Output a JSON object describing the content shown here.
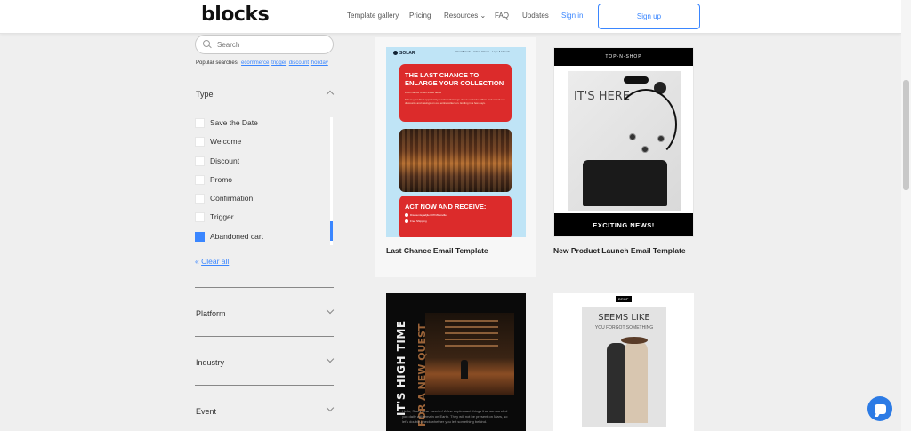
{
  "header": {
    "logo": "blocks",
    "nav": {
      "gallery": "Template gallery",
      "pricing": "Pricing",
      "resources": "Resources ⌄",
      "faq": "FAQ",
      "updates": "Updates",
      "signin": "Sign in"
    },
    "signup": "Sign up"
  },
  "sidebar": {
    "search": {
      "placeholder": "Search"
    },
    "popular": {
      "label": "Popular searches:",
      "links": [
        "ecommerce",
        "trigger",
        "discount",
        "holiday"
      ]
    },
    "type": {
      "title": "Type",
      "options": [
        {
          "label": "Save the Date",
          "checked": false
        },
        {
          "label": "Welcome",
          "checked": false
        },
        {
          "label": "Discount",
          "checked": false
        },
        {
          "label": "Promo",
          "checked": false
        },
        {
          "label": "Confirmation",
          "checked": false
        },
        {
          "label": "Trigger",
          "checked": false
        },
        {
          "label": "Abandoned cart",
          "checked": true
        }
      ]
    },
    "clear_all": "Clear all",
    "clear_prefix": "«",
    "sections": {
      "platform": "Platform",
      "industry": "Industry",
      "event": "Event"
    }
  },
  "cards": {
    "solar": {
      "brand": "SOLAR",
      "nav": [
        "Client Brands",
        "Active Clients",
        "Logo & Visuals"
      ],
      "headline": "THE LAST CHANCE TO ENLARGE YOUR COLLECTION",
      "sub": "Last chance to win these deals",
      "body": "This is your final opportunity to take advantage of our exclusive offers and unlock our discounts and savings on our entire collection. Ending in a few days.",
      "act": "ACT NOW AND RECEIVE:",
      "items": [
        "Discountsgadjiler Off Mitesville",
        "Free Shipping"
      ],
      "label": "Last Chance Email Template"
    },
    "shop": {
      "brand": "TOP-N-SHOP",
      "photo_text": "IT'S HERE",
      "bottom": "EXCITING NEWS!",
      "label": "New Product Launch Email Template"
    },
    "dark": {
      "vertical": "IT'S HIGH TIME",
      "vertical2": "FOR A NEW QUEST",
      "body": "Hello, Stacy dear traveler! A few unpleasant things that surrounded you daily will remain on Earth. They will not be present on Mars, so let's double-check whether you left something behind."
    },
    "fashion": {
      "drop": "DROP",
      "seems": "SEEMS LIKE",
      "forgot": "YOU FORGOT SOMETHING"
    }
  },
  "colors": {
    "accent": "#3a86ff",
    "red": "#dc2b2b"
  }
}
